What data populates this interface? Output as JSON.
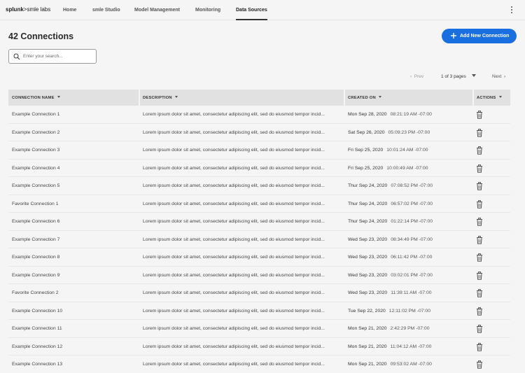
{
  "app": {
    "logo_brand": "splunk",
    "logo_suffix": ">smle labs"
  },
  "nav": {
    "items": [
      {
        "label": "Home"
      },
      {
        "label": "smle Studio"
      },
      {
        "label": "Model Management"
      },
      {
        "label": "Monitoring"
      },
      {
        "label": "Data Sources",
        "active": true
      }
    ]
  },
  "page": {
    "title": "42 Connections",
    "add_button": "Add New Connection",
    "search_placeholder": "Enter your search..."
  },
  "pagination": {
    "prev": "Prev",
    "page_select": "1 of 3 pages",
    "next": "Next"
  },
  "table": {
    "headers": [
      "CONNECTION NAME",
      "DESCRIPTION",
      "CREATED ON",
      "ACTIONS"
    ],
    "rows": [
      {
        "name": "Example Connection 1",
        "description": "Lorem ipsum dolor sit amet, consectetur adipiscing elit, sed do eiusmod tempor incid...",
        "date": "Mon Sep 28, 2020",
        "time": "08:21:19 AM -07:00"
      },
      {
        "name": "Example Connection 2",
        "description": "Lorem ipsum dolor sit amet, consectetur adipiscing elit, sed do eiusmod tempor incid...",
        "date": "Sat Sep 26, 2020",
        "time": "05:09:23 PM -07:00"
      },
      {
        "name": "Example Connection 3",
        "description": "Lorem ipsum dolor sit amet, consectetur adipiscing elit, sed do eiusmod tempor incid...",
        "date": "Fri Sep 25, 2020",
        "time": "10:01:24 AM -07:00"
      },
      {
        "name": "Example Connection 4",
        "description": "Lorem ipsum dolor sit amet, consectetur adipiscing elit, sed do eiusmod tempor incid...",
        "date": "Fri Sep 25, 2020",
        "time": "10:00:49 AM -07:00"
      },
      {
        "name": "Example Connection 5",
        "description": "Lorem ipsum dolor sit amet, consectetur adipiscing elit, sed do eiusmod tempor incid...",
        "date": "Thur Sep 24, 2020",
        "time": "07:08:52 PM -07:00"
      },
      {
        "name": "Favorite Connection 1",
        "description": "Lorem ipsum dolor sit amet, consectetur adipiscing elit, sed do eiusmod tempor incid...",
        "date": "Thur Sep 24, 2020",
        "time": "06:57:02 PM -07:00"
      },
      {
        "name": "Example Connection 6",
        "description": "Lorem ipsum dolor sit amet, consectetur adipiscing elit, sed do eiusmod tempor incid...",
        "date": "Thur Sep 24, 2020",
        "time": "01:22:14 PM -07:00"
      },
      {
        "name": "Example Connection 7",
        "description": "Lorem ipsum dolor sit amet, consectetur adipiscing elit, sed do eiusmod tempor incid...",
        "date": "Wed Sep 23, 2020",
        "time": "08:34:49 PM -07:00"
      },
      {
        "name": "Example Connection 8",
        "description": "Lorem ipsum dolor sit amet, consectetur adipiscing elit, sed do eiusmod tempor incid...",
        "date": "Wed Sep 23, 2020",
        "time": "06:11:42 PM -07:00"
      },
      {
        "name": "Example Connection 9",
        "description": "Lorem ipsum dolor sit amet, consectetur adipiscing elit, sed do eiusmod tempor incid...",
        "date": "Wed Sep 23, 2020",
        "time": "03:02:01 PM -07:00"
      },
      {
        "name": "Favorite Connection 2",
        "description": "Lorem ipsum dolor sit amet, consectetur adipiscing elit, sed do eiusmod tempor incid...",
        "date": "Wed Sep 23, 2020",
        "time": "11:39:11 AM -07:00"
      },
      {
        "name": "Example Connection 10",
        "description": "Lorem ipsum dolor sit amet, consectetur adipiscing elit, sed do eiusmod tempor incid...",
        "date": "Tue Sep 22, 2020",
        "time": "12:11:02 PM -07:00"
      },
      {
        "name": "Example Connection 11",
        "description": "Lorem ipsum dolor sit amet, consectetur adipiscing elit, sed do eiusmod tempor incid...",
        "date": "Mon Sep 21, 2020",
        "time": "2:42:29 PM -07:00"
      },
      {
        "name": "Example Connection 12",
        "description": "Lorem ipsum dolor sit amet, consectetur adipiscing elit, sed do eiusmod tempor incid...",
        "date": "Mon Sep 21, 2020",
        "time": "11:04:12 AM -07:00"
      },
      {
        "name": "Example Connection 13",
        "description": "Lorem ipsum dolor sit amet, consectetur adipiscing elit, sed do eiusmod tempor incid...",
        "date": "Mon Sep 21, 2020",
        "time": "09:53:02 AM -07:00"
      }
    ]
  },
  "icons": {
    "search": "search-icon",
    "plus": "plus-icon",
    "trash": "trash-icon",
    "kebab": "more-vertical-icon"
  },
  "colors": {
    "accent": "#1a6fe0",
    "header_bg": "#e1e1e1",
    "page_bg": "#f5f5f5"
  }
}
